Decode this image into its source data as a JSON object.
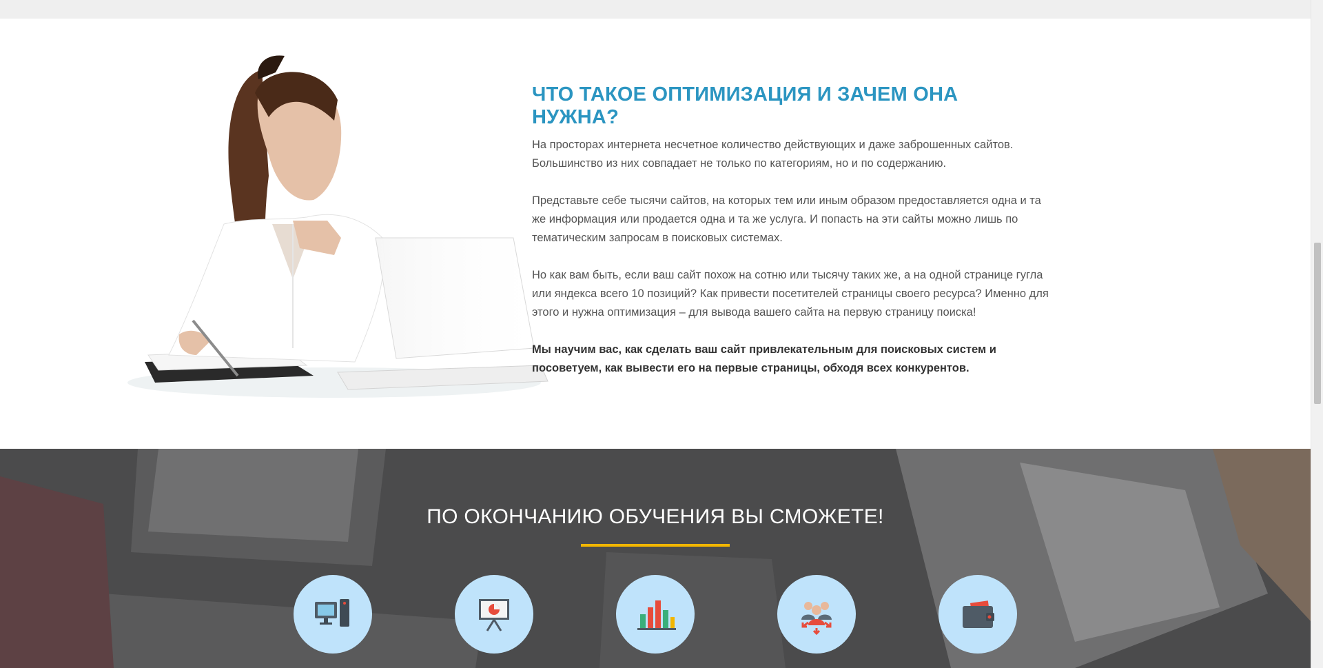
{
  "intro": {
    "title": "ЧТО ТАКОЕ ОПТИМИЗАЦИЯ И ЗАЧЕМ ОНА НУЖНА?",
    "paragraphs": [
      "На просторах интернета несчетное количество действующих и даже заброшенных сайтов. Большинство из них совпадает не только по категориям, но и по содержанию.",
      "Представьте себе тысячи сайтов, на которых тем или иным образом предоставляется одна и та же информация или продается одна и та же услуга. И попасть на эти сайты можно лишь по тематическим запросам в поисковых системах.",
      "Но как вам быть, если ваш сайт похож на сотню или тысячу таких же, а на одной странице гугла или яндекса всего 10 позиций? Как привести посетителей страницы своего ресурса? Именно для этого и нужна оптимизация – для вывода вашего сайта на первую страницу поиска!"
    ],
    "highlight": "Мы научим вас, как сделать ваш сайт привлекательным для поисковых систем и посоветуем, как вывести его на первые страницы, обходя всех конкурентов."
  },
  "outcomes": {
    "title": "ПО ОКОНЧАНИЮ ОБУЧЕНИЯ ВЫ СМОЖЕТЕ!",
    "accent_color": "#f2b600",
    "icons": [
      "computer-tower-icon",
      "presentation-board-icon",
      "bar-chart-icon",
      "team-icon",
      "wallet-icon"
    ]
  },
  "colors": {
    "title_blue": "#2b95c1",
    "circle_bg": "#bfe3fb",
    "dark_section_bg": "#4e4e4f"
  }
}
